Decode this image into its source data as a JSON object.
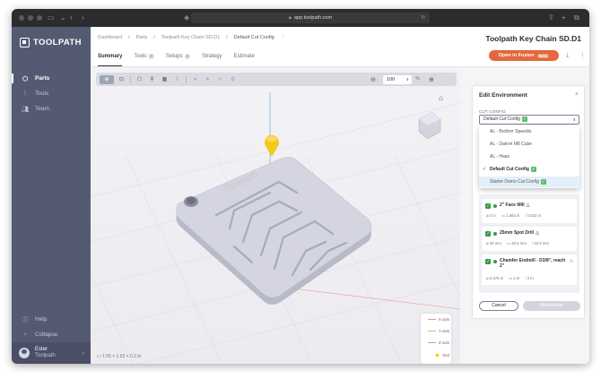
{
  "browser": {
    "url": "app.toolpath.com"
  },
  "sidebar": {
    "logo_text": "TOOLPATH",
    "items": [
      {
        "label": "Parts",
        "icon": "cube-icon",
        "active": true
      },
      {
        "label": "Tools",
        "icon": "tool-icon",
        "active": false
      },
      {
        "label": "Team",
        "icon": "team-icon",
        "active": false
      }
    ],
    "bottom": [
      {
        "label": "Help",
        "icon": "help-icon"
      },
      {
        "label": "Collapse",
        "icon": "collapse-icon"
      }
    ],
    "user": {
      "name": "Ester",
      "org": "Toolpath"
    }
  },
  "header": {
    "breadcrumb": [
      "Dashboard",
      "/",
      "Parts",
      "/",
      "Toolpath Key Chain SD.D1",
      "/",
      "Default Cut Config",
      "⋮"
    ],
    "title": "Toolpath Key Chain SD.D1",
    "open_button": "Open in Fusion",
    "beta_label": "Beta"
  },
  "tabs": [
    {
      "label": "Summary",
      "badge": "",
      "active": true
    },
    {
      "label": "Tools",
      "badge": "3",
      "active": false
    },
    {
      "label": "Setups",
      "badge": "2",
      "active": false
    },
    {
      "label": "Strategy",
      "badge": "",
      "active": false
    },
    {
      "label": "Estimate",
      "badge": "",
      "active": false
    }
  ],
  "viewport": {
    "zoom_value": "100",
    "zoom_unit": "%",
    "dimensions": "1.55 × 1.52 × 0.2 in",
    "legend": [
      "X axis",
      "Y axis",
      "Z axis",
      "Tool"
    ],
    "model_text": "Toolpath"
  },
  "panel": {
    "title": "Edit Environment",
    "section_label": "CUT CONFIG",
    "selected_value": "Default Cut Config",
    "options": [
      {
        "label": "AL - Brother Speedio",
        "selected": false,
        "hover": false,
        "check": false
      },
      {
        "label": "AL - Datron M8 Cube",
        "selected": false,
        "hover": false,
        "check": false
      },
      {
        "label": "AL - Haas",
        "selected": false,
        "hover": false,
        "check": false
      },
      {
        "label": "Default Cut Config",
        "selected": true,
        "hover": false,
        "check": true
      },
      {
        "label": "Starter Demo Cut Config",
        "selected": false,
        "hover": true,
        "check": true
      }
    ],
    "tools": [
      {
        "name": "2\" Face Mill",
        "specs": [
          "2 in",
          "1.563 in",
          "0.633 in"
        ]
      },
      {
        "name": "25mm Spot Drill",
        "specs": [
          "25 mm",
          "40.5 mm",
          "40.5 mm"
        ]
      },
      {
        "name": "Chamfer Endmill - D3/8\", reach 2\"",
        "specs": [
          "0.375 in",
          "2 in",
          "2 in"
        ]
      }
    ],
    "cancel_label": "Cancel",
    "recalculate_label": "Recalculate"
  },
  "colors": {
    "sidebar_bg": "#555a73",
    "accent_orange": "#e3683a",
    "success_green": "#3a9a4a",
    "tool_marker_yellow": "#f2c81c"
  }
}
